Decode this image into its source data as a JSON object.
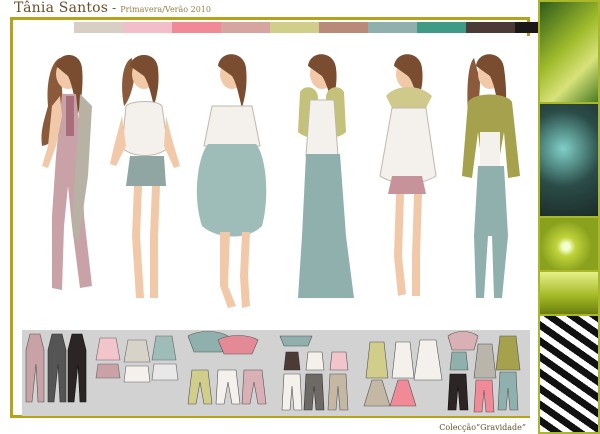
{
  "header": {
    "designer": "Tânia Santos",
    "separator": "-",
    "season": "Primavera/Verão 2010"
  },
  "palette": [
    "#d8cfc4",
    "#f2bfc8",
    "#f08a97",
    "#d6a5a0",
    "#d1cd8a",
    "#b98a7a",
    "#8fb0ad",
    "#3f9a86",
    "#4b3a36",
    "#1a1918"
  ],
  "collection_label": "Colecção“Gravidade”",
  "colors": {
    "accent_border": "#b7a31a",
    "side_panel": "#a9b82b",
    "flats_background": "#d2d2d2"
  },
  "side_panel": [
    "green-leaf-tile",
    "dandelion-tile",
    "water-drop-tile",
    "splash-tile",
    "black-white-tile"
  ]
}
